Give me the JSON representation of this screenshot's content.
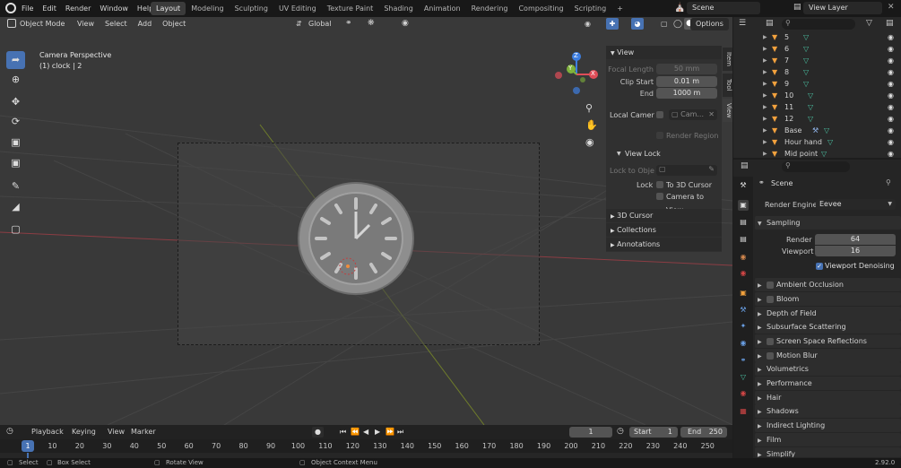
{
  "topbar": {
    "menus": [
      "File",
      "Edit",
      "Render",
      "Window",
      "Help"
    ],
    "workspaces": [
      "Layout",
      "Modeling",
      "Sculpting",
      "UV Editing",
      "Texture Paint",
      "Shading",
      "Animation",
      "Rendering",
      "Compositing",
      "Scripting"
    ],
    "active_workspace": "Layout",
    "add_tab": "+",
    "scene": "Scene",
    "view_layer": "View Layer"
  },
  "viewport": {
    "mode": "Object Mode",
    "menus": [
      "View",
      "Select",
      "Add",
      "Object"
    ],
    "transform": "Global",
    "options": "Options",
    "overlay_title": "Camera Perspective",
    "overlay_sub": "(1) clock | 2",
    "gizmo": {
      "x": "X",
      "y": "Y",
      "z": "Z"
    }
  },
  "npanel": {
    "tabs": [
      "Item",
      "Tool",
      "View"
    ],
    "view_header": "View",
    "focal_label": "Focal Length",
    "focal_value": "50 mm",
    "clip_start_label": "Clip Start",
    "clip_start_value": "0.01 m",
    "end_label": "End",
    "end_value": "1000 m",
    "local_camera_label": "Local Camer",
    "local_camera_value": "Cam...",
    "render_region": "Render Region",
    "view_lock_header": "View Lock",
    "lock_to_obj": "Lock to Obje",
    "lock_label": "Lock",
    "to_3d_cursor": "To 3D Cursor",
    "camera_to_view": "Camera to View",
    "sections": [
      "3D Cursor",
      "Collections",
      "Annotations"
    ]
  },
  "outliner": {
    "rows": [
      "5",
      "6",
      "7",
      "8",
      "9",
      "10",
      "11",
      "12",
      "Base",
      "Hour hand",
      "Mid point"
    ]
  },
  "properties": {
    "scene_name": "Scene",
    "render_engine_label": "Render Engine",
    "render_engine_value": "Eevee",
    "sampling": "Sampling",
    "render_label": "Render",
    "render_value": "64",
    "viewport_label": "Viewport",
    "viewport_value": "16",
    "viewport_denoising": "Viewport Denoising",
    "sections": [
      "Ambient Occlusion",
      "Bloom",
      "Depth of Field",
      "Subsurface Scattering",
      "Screen Space Reflections",
      "Motion Blur",
      "Volumetrics",
      "Performance",
      "Hair",
      "Shadows",
      "Indirect Lighting",
      "Film",
      "Simplify"
    ],
    "checkbox_sections": [
      "Ambient Occlusion",
      "Bloom",
      "Screen Space Reflections",
      "Motion Blur"
    ]
  },
  "timeline": {
    "menus": [
      "Playback",
      "Keying",
      "View",
      "Marker"
    ],
    "current_frame": "1",
    "start_label": "Start",
    "start_value": "1",
    "end_label": "End",
    "end_value": "250",
    "ticks": [
      "1",
      "10",
      "20",
      "30",
      "40",
      "50",
      "60",
      "70",
      "80",
      "90",
      "100",
      "110",
      "120",
      "130",
      "140",
      "150",
      "160",
      "170",
      "180",
      "190",
      "200",
      "210",
      "220",
      "230",
      "240",
      "250"
    ]
  },
  "statusbar": {
    "select": "Select",
    "box_select": "Box Select",
    "rotate_view": "Rotate View",
    "context_menu": "Object Context Menu",
    "version": "2.92.0"
  },
  "colors": {
    "accent": "#4772b3",
    "x_axis": "#e04d58",
    "y_axis": "#7fb23b",
    "z_axis": "#3d7ee0"
  }
}
